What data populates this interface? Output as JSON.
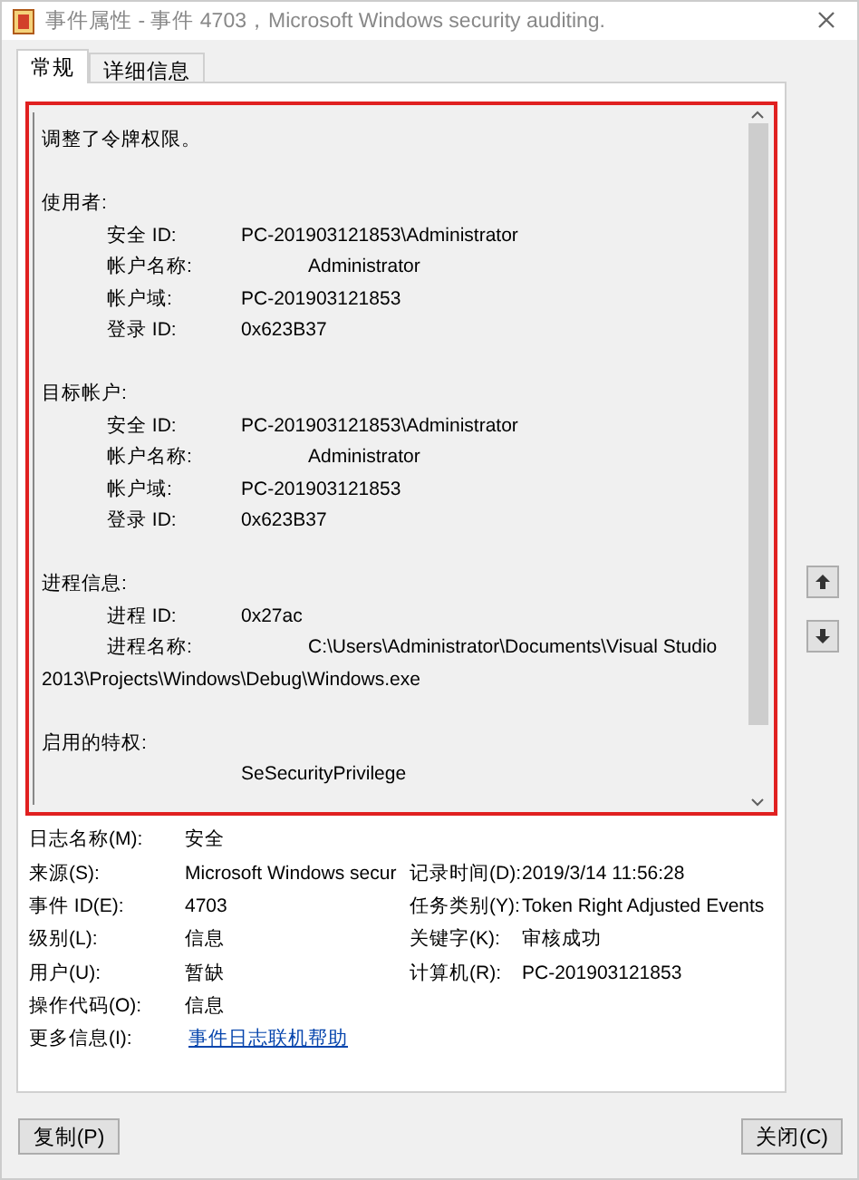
{
  "window": {
    "title": "事件属性 - 事件 4703，Microsoft Windows security auditing."
  },
  "tabs": [
    {
      "label": "常规",
      "selected": true
    },
    {
      "label": "详细信息",
      "selected": false
    }
  ],
  "description": [
    {
      "kind": "text",
      "text": "调整了令牌权限。"
    },
    {
      "kind": "blank"
    },
    {
      "kind": "text",
      "text": "使用者:"
    },
    {
      "kind": "pair",
      "label": "安全 ID:",
      "value": "PC-201903121853\\Administrator"
    },
    {
      "kind": "pair_far",
      "label": "帐户名称:",
      "value": "Administrator"
    },
    {
      "kind": "pair",
      "label": "帐户域:",
      "value": "PC-201903121853"
    },
    {
      "kind": "pair",
      "label": "登录 ID:",
      "value": "0x623B37"
    },
    {
      "kind": "blank"
    },
    {
      "kind": "text",
      "text": "目标帐户:"
    },
    {
      "kind": "pair",
      "label": "安全 ID:",
      "value": "PC-201903121853\\Administrator"
    },
    {
      "kind": "pair_far",
      "label": "帐户名称:",
      "value": "Administrator"
    },
    {
      "kind": "pair",
      "label": "帐户域:",
      "value": "PC-201903121853"
    },
    {
      "kind": "pair",
      "label": "登录 ID:",
      "value": "0x623B37"
    },
    {
      "kind": "blank"
    },
    {
      "kind": "text",
      "text": "进程信息:"
    },
    {
      "kind": "pair",
      "label": "进程 ID:",
      "value": "0x27ac"
    },
    {
      "kind": "pair_far",
      "label": "进程名称:",
      "value": "C:\\Users\\Administrator\\Documents\\Visual Studio"
    },
    {
      "kind": "text",
      "text": "2013\\Projects\\Windows\\Debug\\Windows.exe"
    },
    {
      "kind": "blank"
    },
    {
      "kind": "text",
      "text": "启用的特权:"
    },
    {
      "kind": "value_only",
      "value": "SeSecurityPrivilege"
    }
  ],
  "details": [
    {
      "label": "日志名称(M):",
      "value": "安全"
    },
    {
      "label": "来源(S):",
      "value": "Microsoft Windows secur",
      "label2": "记录时间(D):",
      "value2": "2019/3/14 11:56:28"
    },
    {
      "label": "事件 ID(E):",
      "value": "4703",
      "label2": "任务类别(Y):",
      "value2": "Token Right Adjusted Events"
    },
    {
      "label": "级别(L):",
      "value": "信息",
      "label2": "关键字(K):",
      "value2": "审核成功"
    },
    {
      "label": "用户(U):",
      "value": "暂缺",
      "label2": "计算机(R):",
      "value2": "PC-201903121853"
    },
    {
      "label": "操作代码(O):",
      "value": "信息"
    },
    {
      "label": "更多信息(I):",
      "link": "事件日志联机帮助"
    }
  ],
  "buttons": {
    "copy": "复制(P)",
    "close": "关闭(C)"
  }
}
